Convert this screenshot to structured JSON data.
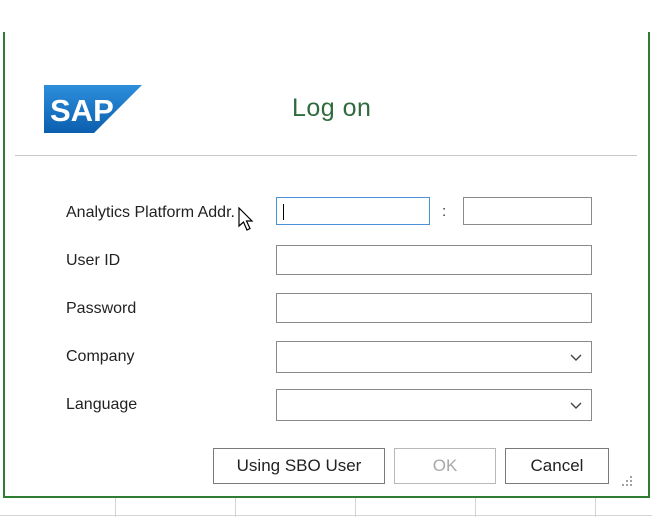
{
  "dialog": {
    "title": "Log on",
    "logo_text": "SAP",
    "brand_color": "#1b6fc0",
    "title_color": "#2f6b3e"
  },
  "form": {
    "analytics_platform_label": "Analytics Platform Addr.",
    "address_separator": ":",
    "address_host_value": "",
    "address_port_value": "",
    "user_id_label": "User ID",
    "user_id_value": "",
    "password_label": "Password",
    "password_value": "",
    "company_label": "Company",
    "company_value": "",
    "language_label": "Language",
    "language_value": ""
  },
  "buttons": {
    "sbo_user_label": "Using SBO User",
    "ok_label": "OK",
    "cancel_label": "Cancel"
  },
  "icons": {
    "company_dropdown": "chevron-down-icon",
    "language_dropdown": "chevron-down-icon",
    "resize": "resize-grip-icon",
    "cursor": "mouse-pointer-icon"
  }
}
